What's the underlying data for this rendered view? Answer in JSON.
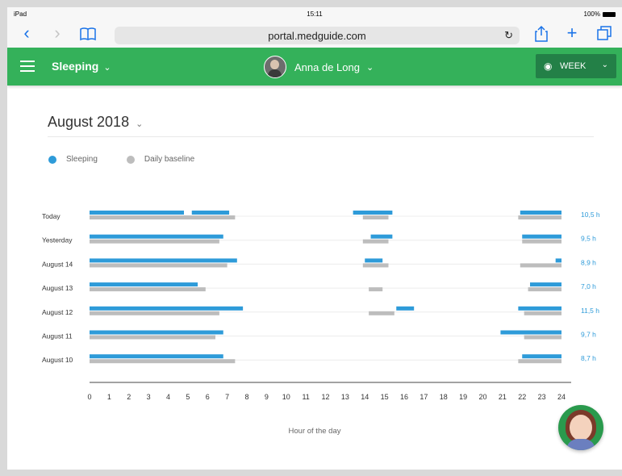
{
  "status_bar": {
    "device": "iPad",
    "time": "15:11",
    "battery": "100%"
  },
  "browser": {
    "url": "portal.medguide.com"
  },
  "app_bar": {
    "section": "Sleeping",
    "user_name": "Anna de Long",
    "period": "WEEK"
  },
  "header": {
    "month": "August 2018"
  },
  "legend": [
    {
      "label": "Sleeping",
      "color": "#2e9bd9"
    },
    {
      "label": "Daily baseline",
      "color": "#bdbdbd"
    }
  ],
  "chart_data": {
    "type": "bar",
    "orientation": "horizontal-timeline",
    "xlabel": "Hour of the day",
    "xlim": [
      0,
      24
    ],
    "x_ticks": [
      "0",
      "1",
      "2",
      "3",
      "4",
      "5",
      "6",
      "7",
      "8",
      "9",
      "10",
      "11",
      "12",
      "13",
      "14",
      "15",
      "16",
      "17",
      "18",
      "19",
      "20",
      "21",
      "22",
      "23",
      "24"
    ],
    "colors": {
      "sleeping": "#2e9bd9",
      "baseline": "#bdbdbd"
    },
    "rows": [
      {
        "label": "Today",
        "total": "10,5 h",
        "sleeping": [
          [
            0,
            4.8
          ],
          [
            5.2,
            7.1
          ],
          [
            13.4,
            15.4
          ],
          [
            21.9,
            24
          ]
        ],
        "baseline": [
          [
            0,
            7.4
          ],
          [
            13.9,
            15.2
          ],
          [
            21.8,
            24
          ]
        ]
      },
      {
        "label": "Yesterday",
        "total": "9,5 h",
        "sleeping": [
          [
            0,
            6.8
          ],
          [
            14.3,
            15.4
          ],
          [
            22.0,
            24
          ]
        ],
        "baseline": [
          [
            0,
            6.6
          ],
          [
            13.9,
            15.2
          ],
          [
            22.0,
            24
          ]
        ]
      },
      {
        "label": "August 14",
        "total": "8,9 h",
        "sleeping": [
          [
            0,
            7.5
          ],
          [
            14.0,
            14.9
          ],
          [
            23.7,
            24
          ]
        ],
        "baseline": [
          [
            0,
            7.0
          ],
          [
            13.9,
            15.2
          ],
          [
            21.9,
            24
          ]
        ]
      },
      {
        "label": "August 13",
        "total": "7,0 h",
        "sleeping": [
          [
            0,
            5.5
          ],
          [
            22.4,
            24
          ]
        ],
        "baseline": [
          [
            0,
            5.9
          ],
          [
            14.2,
            14.9
          ],
          [
            22.3,
            24
          ]
        ]
      },
      {
        "label": "August 12",
        "total": "11,5 h",
        "sleeping": [
          [
            0,
            7.8
          ],
          [
            15.6,
            16.5
          ],
          [
            21.8,
            24
          ]
        ],
        "baseline": [
          [
            0,
            6.6
          ],
          [
            14.2,
            15.5
          ],
          [
            22.1,
            24
          ]
        ]
      },
      {
        "label": "August 11",
        "total": "9,7 h",
        "sleeping": [
          [
            0,
            6.8
          ],
          [
            20.9,
            24
          ]
        ],
        "baseline": [
          [
            0,
            6.4
          ],
          [
            22.1,
            24
          ]
        ]
      },
      {
        "label": "August 10",
        "total": "8,7 h",
        "sleeping": [
          [
            0,
            6.8
          ],
          [
            22.0,
            24
          ]
        ],
        "baseline": [
          [
            0,
            7.4
          ],
          [
            21.8,
            24
          ]
        ]
      }
    ]
  }
}
